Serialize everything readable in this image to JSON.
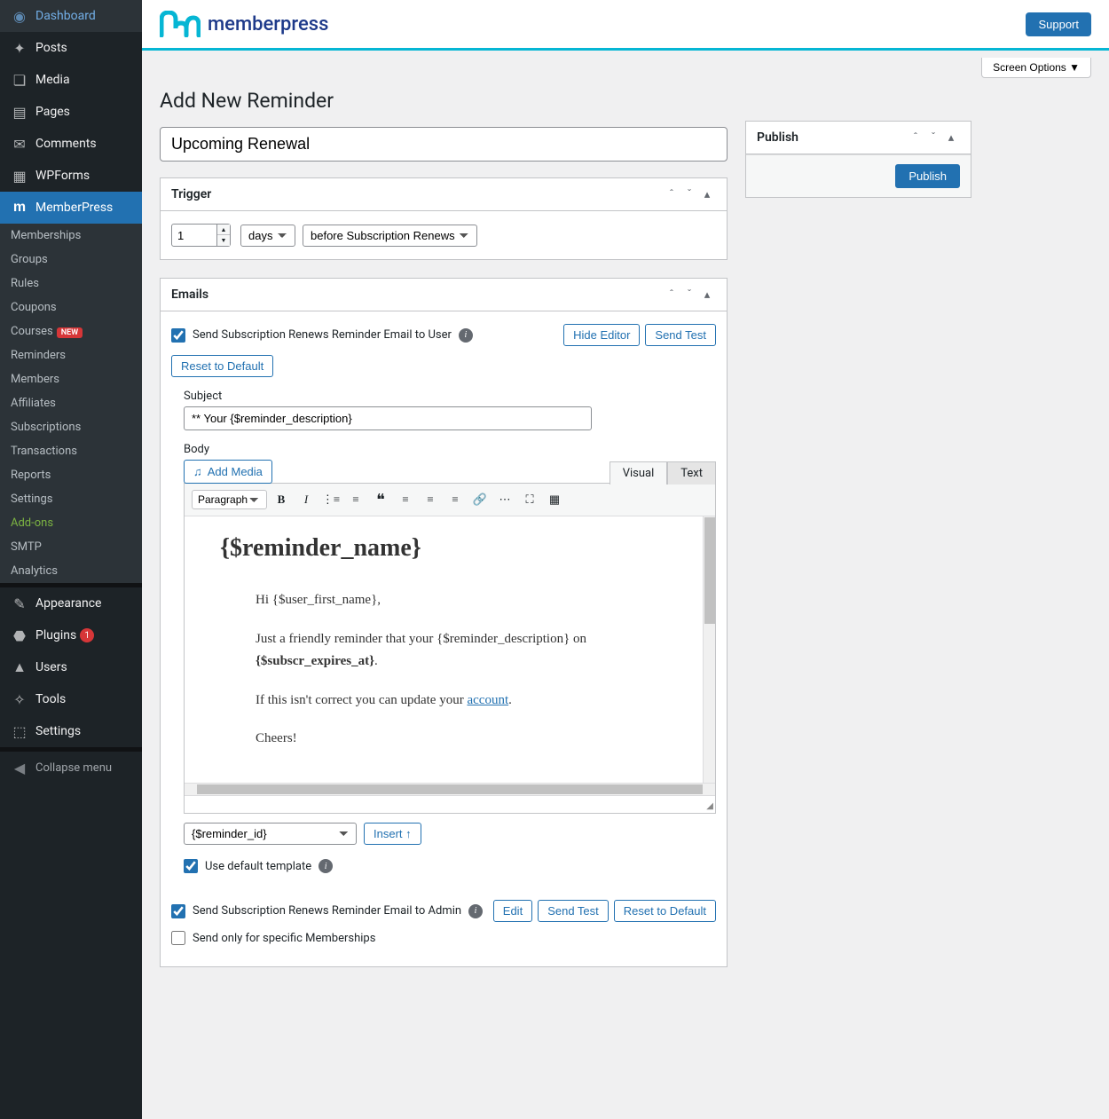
{
  "sidebar": {
    "items": [
      {
        "label": "Dashboard",
        "icon": "⏲"
      },
      {
        "label": "Posts",
        "icon": "📌"
      },
      {
        "label": "Media",
        "icon": "🎵"
      },
      {
        "label": "Pages",
        "icon": "📄"
      },
      {
        "label": "Comments",
        "icon": "💬"
      },
      {
        "label": "WPForms",
        "icon": "☰"
      }
    ],
    "memberpress": {
      "label": "MemberPress",
      "icon": "m"
    },
    "submenu": [
      {
        "label": "Memberships"
      },
      {
        "label": "Groups"
      },
      {
        "label": "Rules"
      },
      {
        "label": "Coupons"
      },
      {
        "label": "Courses",
        "badge": "NEW"
      },
      {
        "label": "Reminders"
      },
      {
        "label": "Members"
      },
      {
        "label": "Affiliates"
      },
      {
        "label": "Subscriptions"
      },
      {
        "label": "Transactions"
      },
      {
        "label": "Reports"
      },
      {
        "label": "Settings"
      },
      {
        "label": "Add-ons",
        "addon": true
      },
      {
        "label": "SMTP"
      },
      {
        "label": "Analytics"
      }
    ],
    "items2": [
      {
        "label": "Appearance",
        "icon": "🖌"
      },
      {
        "label": "Plugins",
        "icon": "🔌",
        "count": "1"
      },
      {
        "label": "Users",
        "icon": "👤"
      },
      {
        "label": "Tools",
        "icon": "🔧"
      },
      {
        "label": "Settings",
        "icon": "⚙"
      }
    ],
    "collapse": "Collapse menu"
  },
  "topbar": {
    "brand": "memberpress",
    "support": "Support"
  },
  "screen_options": "Screen Options ▼",
  "page": {
    "title": "Add New Reminder",
    "reminder_title": "Upcoming Renewal"
  },
  "trigger": {
    "heading": "Trigger",
    "number": "1",
    "unit": "days",
    "event": "before Subscription Renews"
  },
  "emails": {
    "heading": "Emails",
    "user_checkbox": "Send Subscription Renews Reminder Email to User",
    "hide_editor": "Hide Editor",
    "send_test": "Send Test",
    "reset": "Reset to Default",
    "subject_label": "Subject",
    "subject_value": "** Your {$reminder_description}",
    "body_label": "Body",
    "add_media": "Add Media",
    "tab_visual": "Visual",
    "tab_text": "Text",
    "paragraph": "Paragraph",
    "content": {
      "heading": "{$reminder_name}",
      "p1": "Hi {$user_first_name},",
      "p2_a": "Just a friendly reminder that your {$reminder_description} on ",
      "p2_b": "{$subscr_expires_at}",
      "p2_c": ".",
      "p3_a": "If this isn't correct you can update your ",
      "p3_link": "account",
      "p3_b": ".",
      "p4": "Cheers!"
    },
    "insert_var": "{$reminder_id}",
    "insert_btn": "Insert ↑",
    "use_default": "Use default template",
    "admin_checkbox": "Send Subscription Renews Reminder Email to Admin",
    "edit": "Edit",
    "specific_memberships": "Send only for specific Memberships"
  },
  "publish": {
    "heading": "Publish",
    "button": "Publish"
  }
}
